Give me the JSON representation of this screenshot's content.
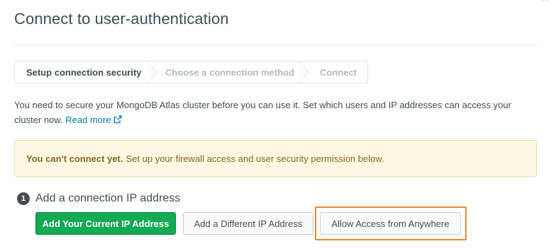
{
  "modal": {
    "title": "Connect to user-authentication",
    "close_glyph": "×"
  },
  "steps": [
    {
      "label": "Setup connection security",
      "state": "active"
    },
    {
      "label": "Choose a connection method",
      "state": "inactive"
    },
    {
      "label": "Connect",
      "state": "inactive"
    }
  ],
  "intro": {
    "text": "You need to secure your MongoDB Atlas cluster before you can use it. Set which users and IP addresses can access your cluster now.",
    "link_label": "Read more",
    "link_icon": "external-link-icon"
  },
  "warning": {
    "strong": "You can't connect yet.",
    "text": "Set up your firewall access and user security permission below."
  },
  "section1": {
    "number": "1",
    "title": "Add a connection IP address",
    "buttons": {
      "current_ip": "Add Your Current IP Address",
      "different_ip": "Add a Different IP Address",
      "anywhere": "Allow Access from Anywhere"
    }
  },
  "colors": {
    "primary_green": "#13aa52",
    "warning_bg": "#fef7e3",
    "warning_text": "#86681d",
    "link": "#007cad",
    "highlight_orange": "#ee8534"
  }
}
